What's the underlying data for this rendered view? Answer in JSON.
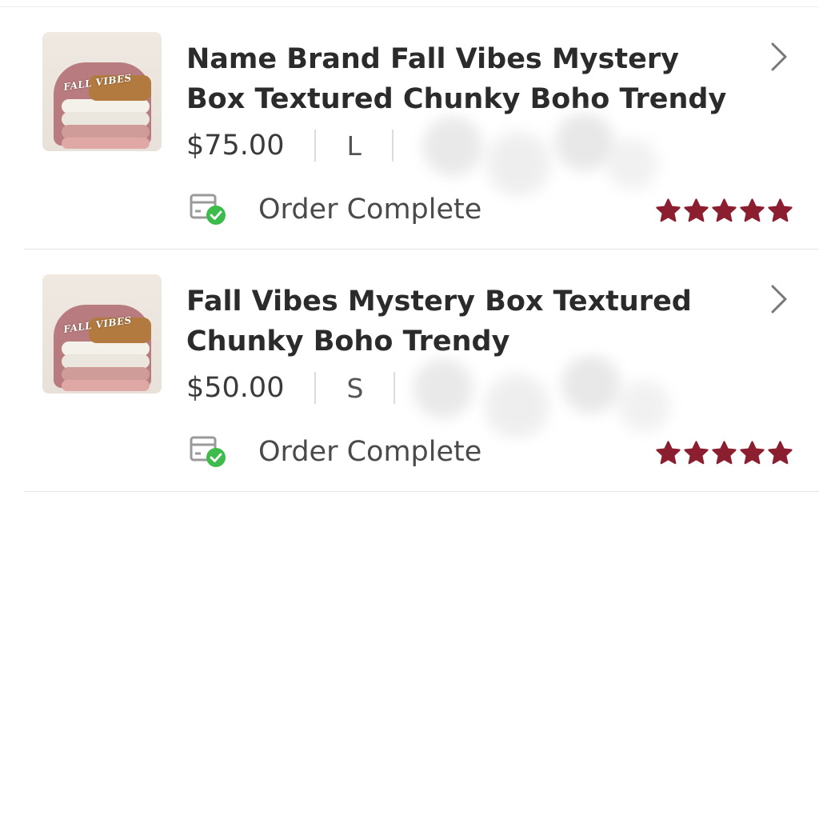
{
  "orders": [
    {
      "thumb_text": "FALL VIBES",
      "title": "Name Brand Fall Vibes Mystery Box Textured Chunky Boho Trendy",
      "price": "$75.00",
      "size": "L",
      "status": "Order Complete",
      "rating": 5
    },
    {
      "thumb_text": "FALL VIBES",
      "title": "Fall Vibes Mystery Box Textured Chunky Boho Trendy",
      "price": "$50.00",
      "size": "S",
      "status": "Order Complete",
      "rating": 5
    }
  ],
  "colors": {
    "star": "#8b1e2f",
    "check": "#3dbb4b",
    "text": "#2b2b2b"
  },
  "icons": {
    "chevron": "chevron-right-icon",
    "status": "package-check-icon",
    "star": "star-icon"
  }
}
